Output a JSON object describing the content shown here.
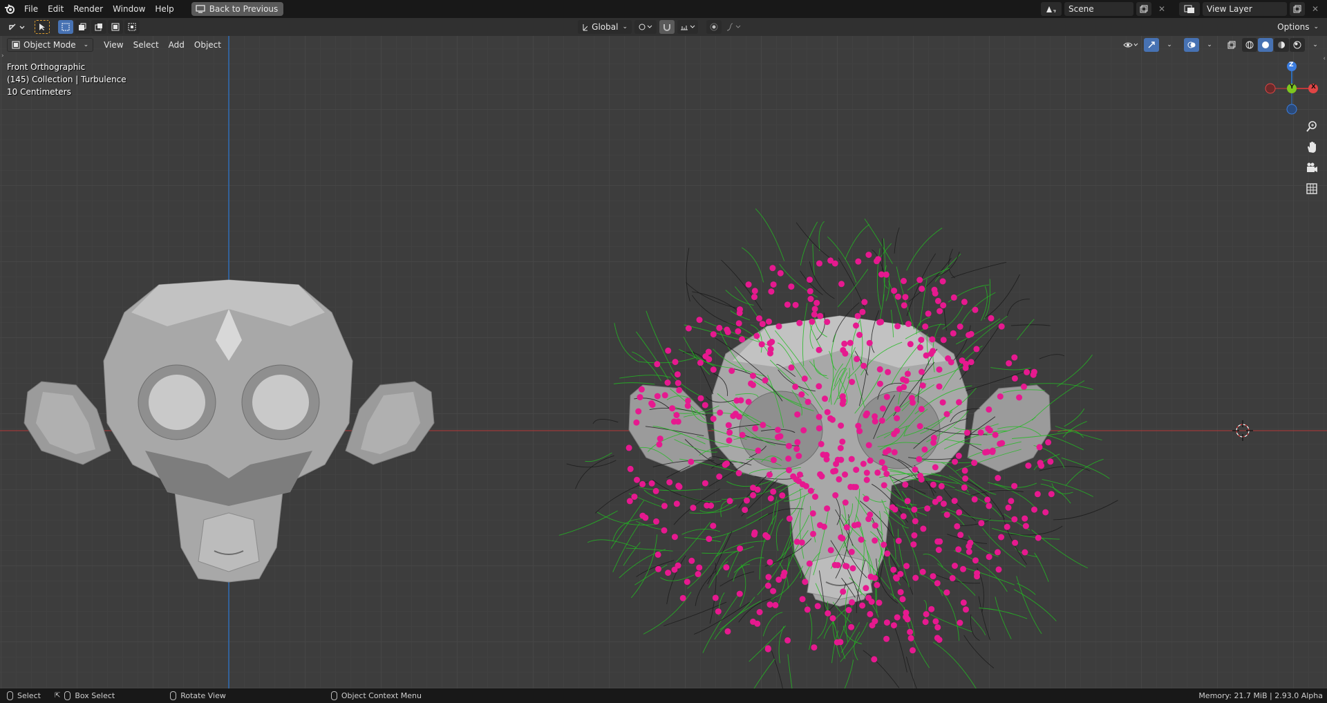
{
  "topbar": {
    "menus": [
      "File",
      "Edit",
      "Render",
      "Window",
      "Help"
    ],
    "back_label": "Back to Previous",
    "scene_name": "Scene",
    "view_layer": "View Layer"
  },
  "toolheader": {
    "orientation": "Global",
    "options_label": "Options"
  },
  "viewport": {
    "mode_label": "Object Mode",
    "menus": [
      "View",
      "Select",
      "Add",
      "Object"
    ],
    "overlay": {
      "view_name": "Front Orthographic",
      "collection_info": "(145) Collection | Turbulence",
      "scale": "10 Centimeters"
    },
    "gizmo": {
      "z": "Z",
      "y": "Y",
      "x": "X"
    }
  },
  "statusbar": {
    "select": "Select",
    "box_select": "Box Select",
    "rotate_view": "Rotate View",
    "context_menu": "Object Context Menu",
    "memory": "Memory: 21.7 MiB | 2.93.0 Alpha"
  },
  "colors": {
    "particles": "#e6198f",
    "hair": "#22bb22",
    "x_axis": "#9b3a3a",
    "z_axis": "#2f6db5",
    "accent": "#4772b3"
  }
}
